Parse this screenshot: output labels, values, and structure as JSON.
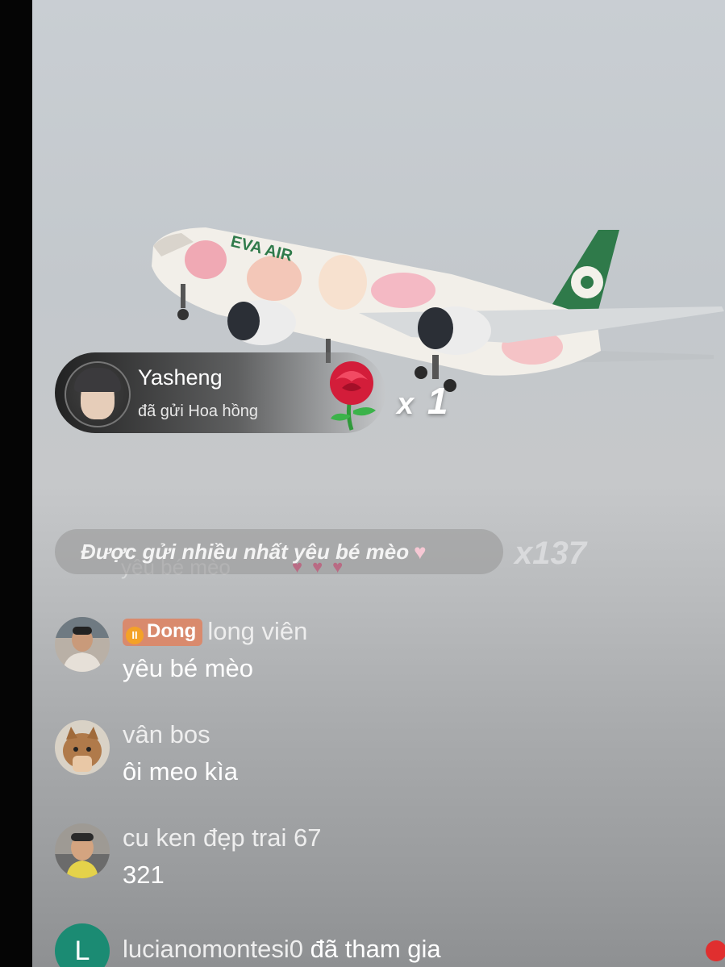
{
  "gift_banner": {
    "username": "Yasheng",
    "action": "đã gửi Hoa hồng",
    "count_prefix": "x",
    "count": "1",
    "gift_icon": "rose-icon"
  },
  "top_gift": {
    "label": "Được gửi nhiều nhất yêu bé mèo",
    "heart_icon": "heart-icon",
    "count": "x137",
    "faded_comment": "yêu bé mèo"
  },
  "comments": [
    {
      "badge": "Dong",
      "name": "long viên",
      "text": "yêu bé mèo"
    },
    {
      "name": "vân bos",
      "text": "ôi meo kìa"
    },
    {
      "name": "cu ken đẹp trai 67",
      "text": "321"
    }
  ],
  "join": {
    "avatar_letter": "L",
    "name": "lucianomontesi0",
    "action": "đã tham gia"
  },
  "colors": {
    "badge": "#d98a6d",
    "join_avatar": "#1b8b73",
    "notification_dot": "#e02f2f"
  }
}
